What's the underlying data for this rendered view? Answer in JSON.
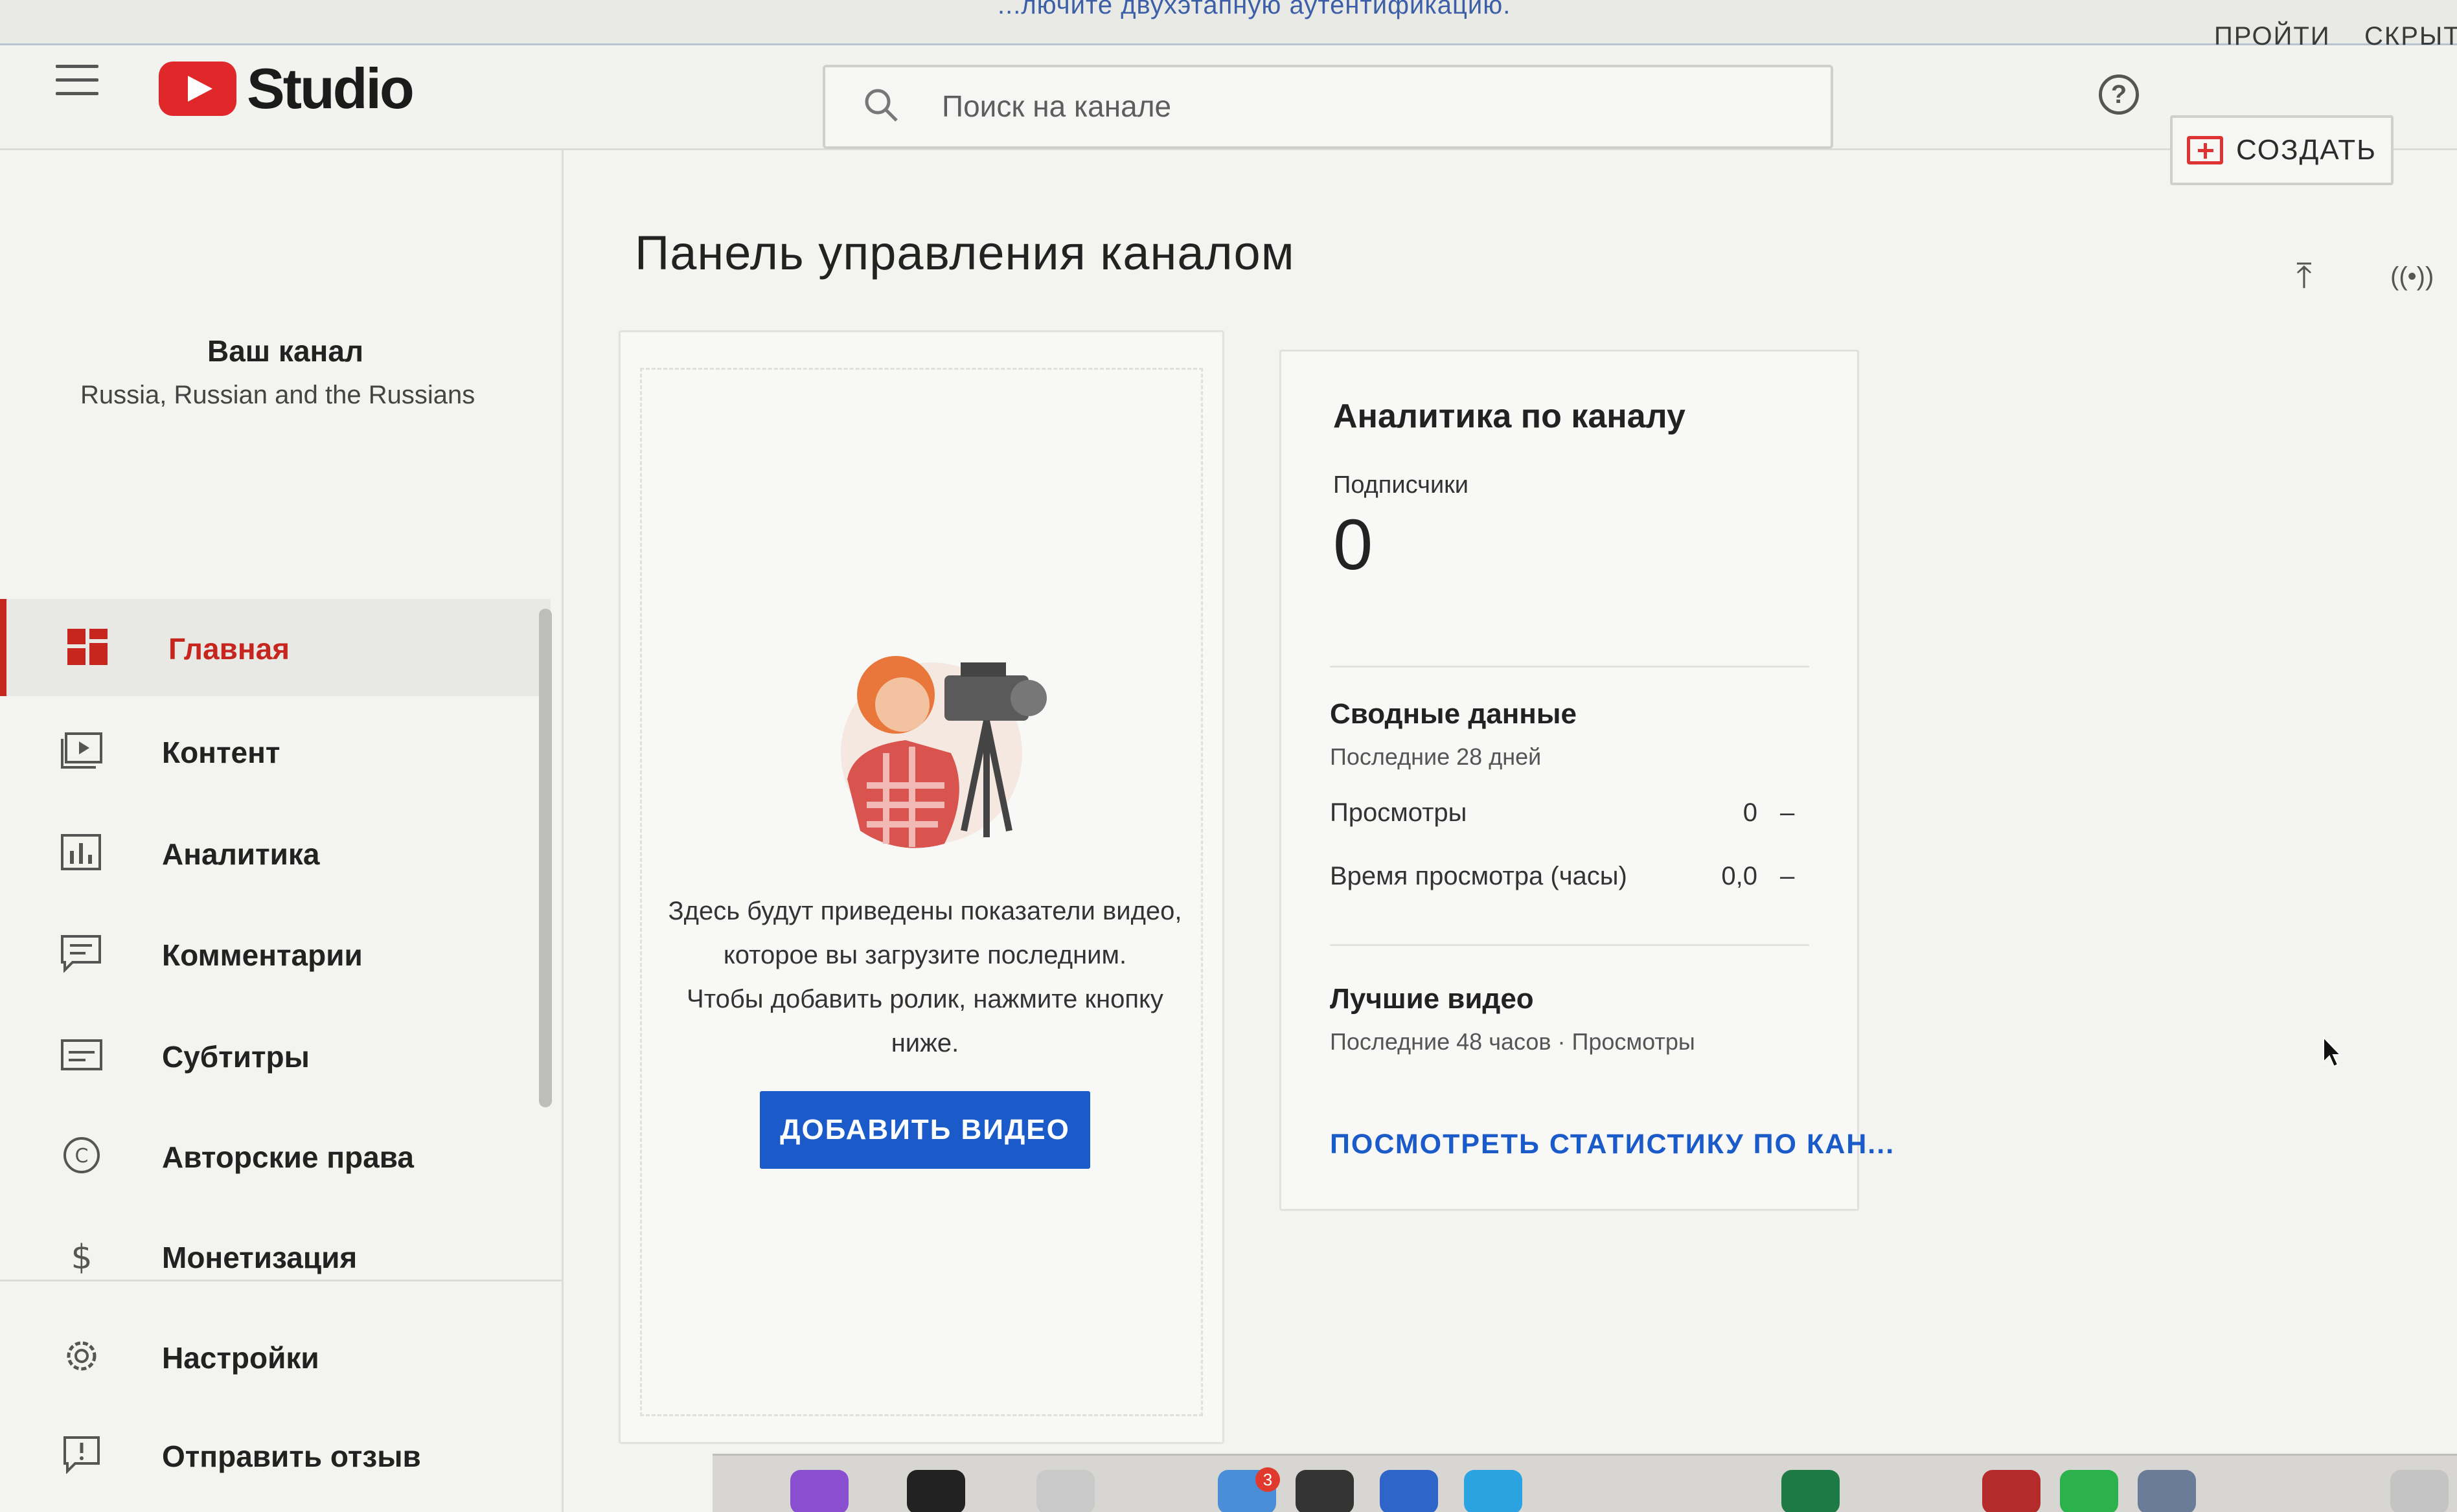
{
  "banner": {
    "text": "...лючите двухэтапную аутентификацию.",
    "pass_label": "ПРОЙТИ",
    "hide_label": "СКРЫТЬ"
  },
  "header": {
    "logo_text": "Studio",
    "search_placeholder": "Поиск на канале",
    "help_label": "?",
    "create_label": "СОЗДАТЬ"
  },
  "sidebar": {
    "channel_title": "Ваш канал",
    "channel_name": "Russia, Russian and the Russians",
    "items": [
      {
        "label": "Главная",
        "icon": "dashboard-icon",
        "active": true
      },
      {
        "label": "Контент",
        "icon": "content-icon",
        "active": false
      },
      {
        "label": "Аналитика",
        "icon": "analytics-icon",
        "active": false
      },
      {
        "label": "Комментарии",
        "icon": "comments-icon",
        "active": false
      },
      {
        "label": "Субтитры",
        "icon": "subtitles-icon",
        "active": false
      },
      {
        "label": "Авторские права",
        "icon": "copyright-icon",
        "active": false
      },
      {
        "label": "Монетизация",
        "icon": "monetization-icon",
        "active": false
      },
      {
        "label": "Настройки",
        "icon": "settings-icon",
        "active": false
      },
      {
        "label": "Отправить отзыв",
        "icon": "feedback-icon",
        "active": false
      }
    ]
  },
  "main": {
    "page_title": "Панель управления каналом",
    "upload_icon": "upload-icon",
    "live_icon": "live-icon"
  },
  "video_card": {
    "text_line1": "Здесь будут приведены показатели видео,",
    "text_line2": "которое вы загрузите последним.",
    "text_line3": "Чтобы добавить ролик, нажмите кнопку",
    "text_line4": "ниже.",
    "button_label": "ДОБАВИТЬ ВИДЕО"
  },
  "analytics_card": {
    "title": "Аналитика по каналу",
    "subscribers_label": "Подписчики",
    "subscribers_value": "0",
    "summary_title": "Сводные данные",
    "summary_period": "Последние 28 дней",
    "views_label": "Просмотры",
    "views_value": "0",
    "views_trend": "–",
    "watchtime_label": "Время просмотра (часы)",
    "watchtime_value": "0,0",
    "watchtime_trend": "–",
    "top_videos_title": "Лучшие видео",
    "top_videos_period": "Последние 48 часов · Просмотры",
    "stats_link": "ПОСМОТРЕТЬ СТАТИСТИКУ ПО КАН..."
  },
  "dock": {
    "badge_count": "3"
  },
  "colors": {
    "accent_red": "#c7261f",
    "link_blue": "#1a5bc9",
    "youtube_red": "#e0282b"
  }
}
